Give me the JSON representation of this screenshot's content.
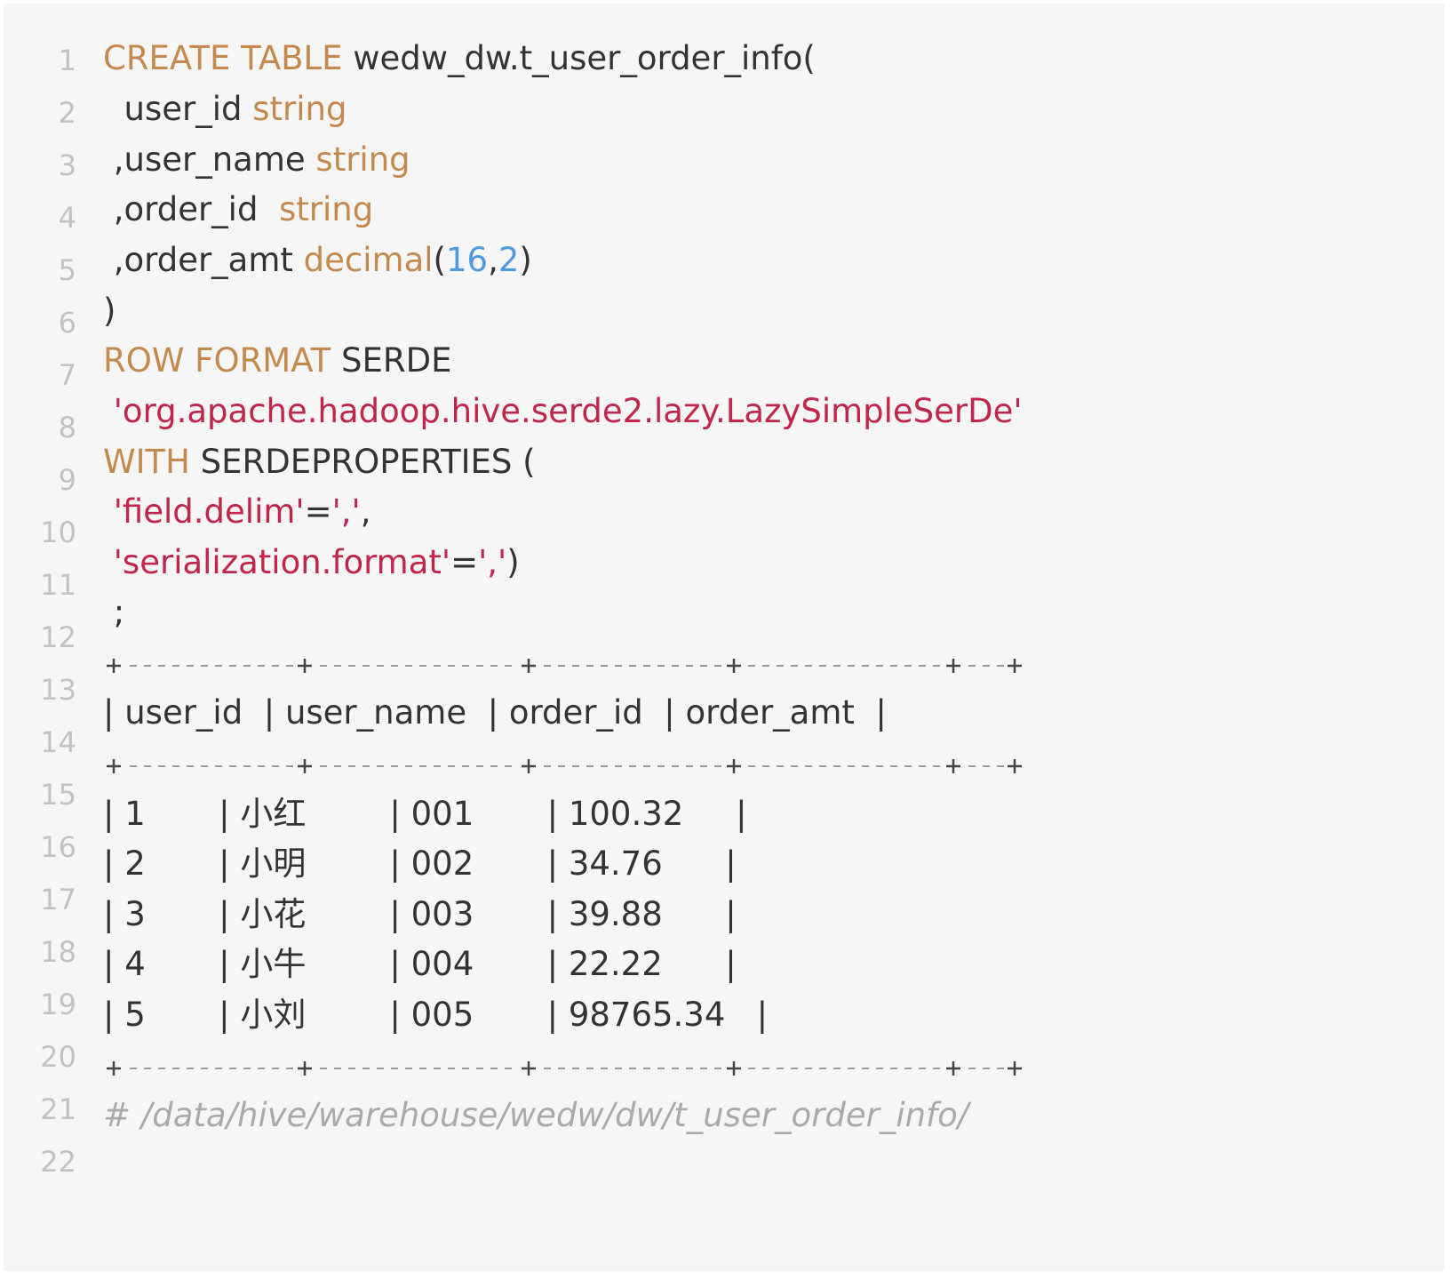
{
  "line_numbers": [
    "1",
    "2",
    "3",
    "4",
    "5",
    "6",
    "7",
    "8",
    "9",
    "10",
    "11",
    "12",
    "13",
    "14",
    "15",
    "16",
    "17",
    "18",
    "19",
    "20",
    "21",
    "22"
  ],
  "code": {
    "l1": {
      "kw": "CREATE TABLE",
      "rest": " wedw_dw.t_user_order_info("
    },
    "l2": {
      "text": "  user_id ",
      "type": "string"
    },
    "l3": {
      "text": " ,user_name ",
      "type": "string"
    },
    "l4": {
      "text": " ,order_id  ",
      "type": "string"
    },
    "l5": {
      "text": " ,order_amt ",
      "type": "decimal",
      "paren_open": "(",
      "n1": "16",
      "comma": ",",
      "n2": "2",
      "paren_close": ")"
    },
    "l6": {
      "text": ")"
    },
    "l7": {
      "kw": "ROW FORMAT",
      "rest": " SERDE"
    },
    "l8": {
      "indent": " ",
      "str": "'org.apache.hadoop.hive.serde2.lazy.LazySimpleSerDe'"
    },
    "l9": {
      "kw": "WITH",
      "rest": " SERDEPROPERTIES ("
    },
    "l10": {
      "indent": " ",
      "str1": "'field.delim'",
      "eq": "=",
      "str2": "','",
      "tail": ","
    },
    "l11": {
      "indent": " ",
      "str1": "'serialization.format'",
      "eq": "=",
      "str2": "','",
      "tail": ")"
    },
    "l12": {
      "text": " ;"
    }
  },
  "table": {
    "header": "| user_id  | user_name  | order_id  | order_amt  |",
    "rows": [
      "| 1       | 小红        | 001       | 100.32     |",
      "| 2       | 小明        | 002       | 34.76      |",
      "| 3       | 小花        | 003       | 39.88      |",
      "| 4       | 小牛        | 004       | 22.22      |",
      "| 5       | 小刘        | 005       | 98765.34   |"
    ]
  },
  "comment": "# /data/hive/warehouse/wedw/dw/t_user_order_info/",
  "colors": {
    "keyword": "#c48a4d",
    "string": "#c0264c",
    "number": "#4e9ae0",
    "comment": "#aaaaaa",
    "text": "#333333",
    "line_number": "#c2c2c2",
    "background": "#f6f6f6"
  }
}
